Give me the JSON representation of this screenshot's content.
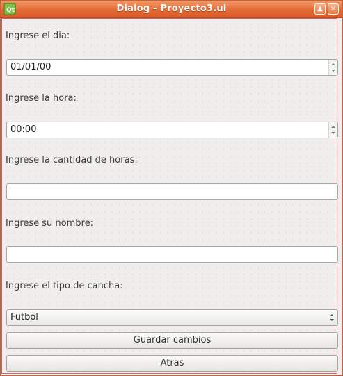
{
  "window": {
    "title": "Dialog - Proyecto3.ui",
    "minimize_glyph": "▲",
    "close_glyph": "×"
  },
  "form": {
    "day_label": "Ingrese el dia:",
    "day_value": "01/01/00",
    "hour_label": "Ingrese la hora:",
    "hour_value": "00:00",
    "hours_amount_label": "Ingrese la cantidad de horas:",
    "hours_amount_value": "",
    "name_label": "Ingrese su nombre:",
    "name_value": "",
    "court_type_label": "Ingrese el tipo de cancha:",
    "court_type_selected": "Futbol"
  },
  "buttons": {
    "save_label": "Guardar cambios",
    "back_label": "Atras"
  },
  "colors": {
    "titlebar": "#e46a33",
    "form_border": "#e8585e",
    "background": "#efeeed"
  }
}
